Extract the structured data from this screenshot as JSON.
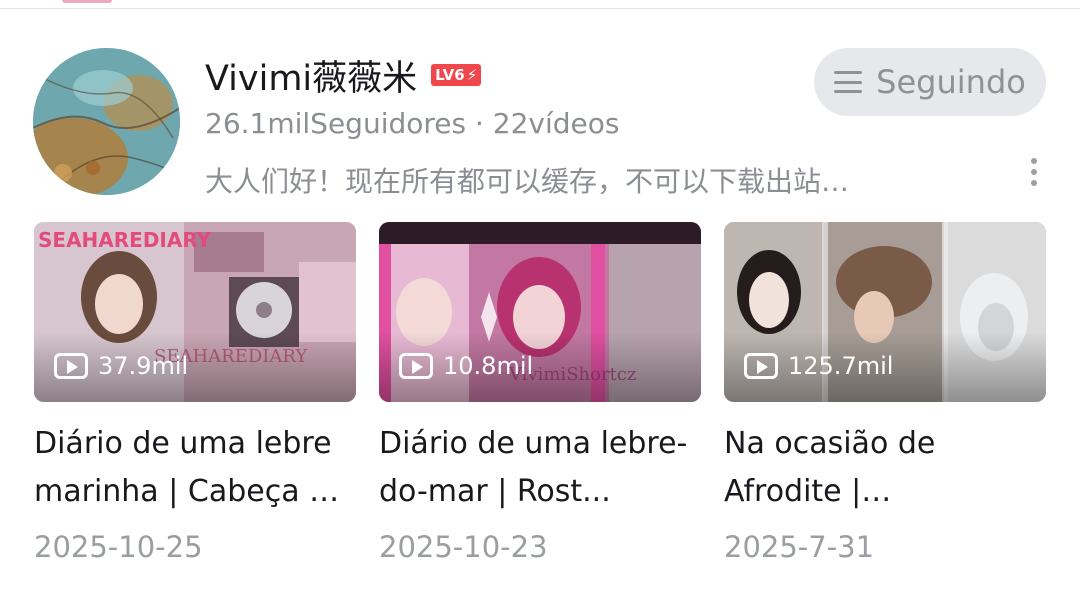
{
  "channel": {
    "name": "Vivimi薇薇米",
    "level_badge": "LV6",
    "stats": "26.1milSeguidores · 22vídeos",
    "bio": "大人们好！现在所有都可以缓存，不可以下载出站…",
    "follow_button_label": "Seguindo",
    "avatar_icon": "avatar-image",
    "more_icon": "more-vertical-icon"
  },
  "videos": [
    {
      "views": "37.9mil",
      "title": "Diário de uma lebre marinha | Cabeça e ...",
      "date": "2025-10-25"
    },
    {
      "views": "10.8mil",
      "title": "Diário de uma lebre-do-mar | Rost...",
      "date": "2025-10-23"
    },
    {
      "views": "125.7mil",
      "title": "Na ocasião de Afrodite | Acelerado...",
      "date": "2025-7-31"
    }
  ],
  "colors": {
    "level_badge": "#f0474c",
    "follow_button_bg": "#e7e8eb",
    "secondary_text": "#8b8e93"
  }
}
